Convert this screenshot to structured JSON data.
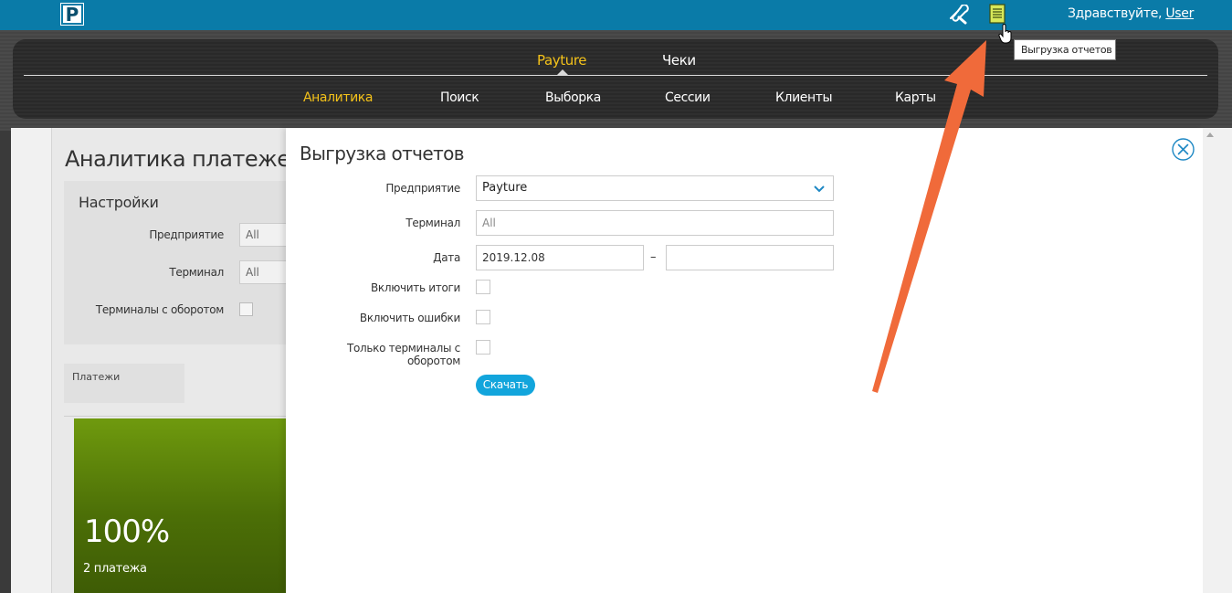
{
  "topbar": {
    "logo_letter": "P",
    "tools_icon": "tools-icon",
    "report_icon": "report-icon",
    "greeting_prefix": "Здравствуйте, ",
    "user_name": "User",
    "tooltip": "Выгрузка отчетов"
  },
  "nav": {
    "primary": [
      {
        "label": "Payture",
        "active": true
      },
      {
        "label": "Чеки",
        "active": false
      }
    ],
    "secondary": [
      {
        "label": "Аналитика",
        "active": true
      },
      {
        "label": "Поиск",
        "active": false
      },
      {
        "label": "Выборка",
        "active": false
      },
      {
        "label": "Сессии",
        "active": false
      },
      {
        "label": "Клиенты",
        "active": false
      },
      {
        "label": "Карты",
        "active": false
      }
    ]
  },
  "background_page": {
    "title": "Аналитика платежей",
    "settings": {
      "title": "Настройки",
      "enterprise_label": "Предприятие",
      "enterprise_value": "All",
      "terminal_label": "Терминал",
      "terminal_value": "All",
      "turnover_label": "Терминалы с оборотом"
    },
    "payments_label": "Платежи",
    "tile": {
      "percent": "100%",
      "count": "2 платежа",
      "color": "#5e8a0b"
    }
  },
  "modal": {
    "title": "Выгрузка отчетов",
    "fields": {
      "enterprise_label": "Предприятие",
      "enterprise_value": "Payture",
      "terminal_label": "Терминал",
      "terminal_placeholder": "All",
      "date_label": "Дата",
      "date_from": "2019.12.08",
      "date_separator": "–",
      "date_to": "",
      "include_totals_label": "Включить итоги",
      "include_errors_label": "Включить ошибки",
      "only_turnover_label": "Только терминалы с оборотом"
    },
    "download_label": "Скачать",
    "close_icon": "close-circle-icon"
  },
  "colors": {
    "topbar": "#0a7ba8",
    "accent": "#f4c21a",
    "button": "#12a5dc",
    "annotation_arrow": "#f06a3a"
  }
}
